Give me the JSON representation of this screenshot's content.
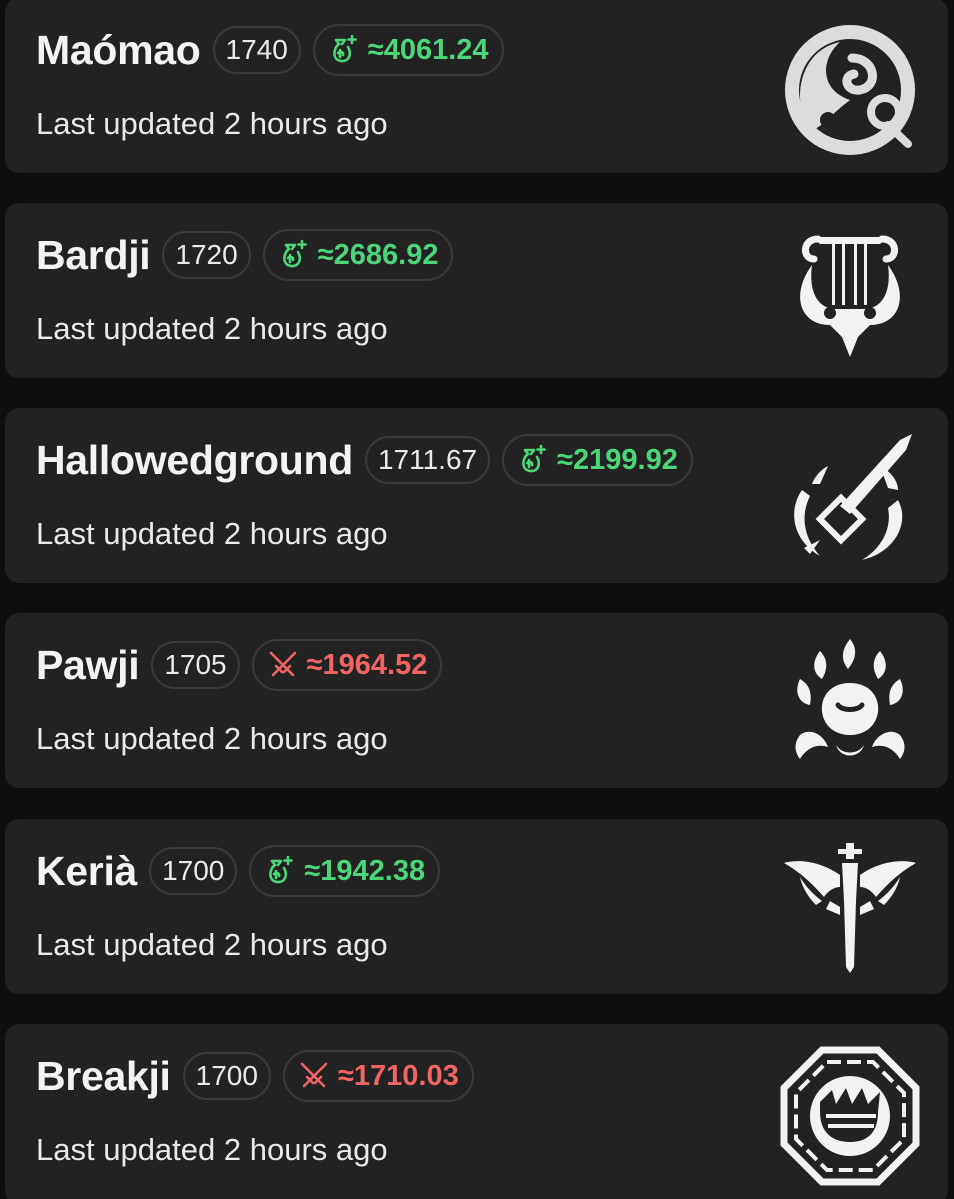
{
  "players": [
    {
      "name": "Maómao",
      "rating": "1740",
      "earn_status": "up",
      "earn_icon": "money-bag-icon",
      "earn": "≈4061.24",
      "updated": "Last updated 2 hours ago",
      "emblem": "spiral-emblem-icon"
    },
    {
      "name": "Bardji",
      "rating": "1720",
      "earn_status": "up",
      "earn_icon": "money-bag-icon",
      "earn": "≈2686.92",
      "updated": "Last updated 2 hours ago",
      "emblem": "lyre-emblem-icon"
    },
    {
      "name": "Hallowedground",
      "rating": "1711.67",
      "earn_status": "up",
      "earn_icon": "money-bag-icon",
      "earn": "≈2199.92",
      "updated": "Last updated 2 hours ago",
      "emblem": "sword-emblem-icon"
    },
    {
      "name": "Pawji",
      "rating": "1705",
      "earn_status": "down",
      "earn_icon": "crossed-swords-icon",
      "earn": "≈1964.52",
      "updated": "Last updated 2 hours ago",
      "emblem": "paw-emblem-icon"
    },
    {
      "name": "Kerià",
      "rating": "1700",
      "earn_status": "up",
      "earn_icon": "money-bag-icon",
      "earn": "≈1942.38",
      "updated": "Last updated 2 hours ago",
      "emblem": "winged-sword-emblem-icon"
    },
    {
      "name": "Breakji",
      "rating": "1700",
      "earn_status": "down",
      "earn_icon": "crossed-swords-icon",
      "earn": "≈1710.03",
      "updated": "Last updated 2 hours ago",
      "emblem": "fist-octagon-emblem-icon"
    }
  ],
  "colors": {
    "background": "#0f0f0f",
    "card": "#222222",
    "positive": "#4bd67a",
    "negative": "#f16464"
  }
}
